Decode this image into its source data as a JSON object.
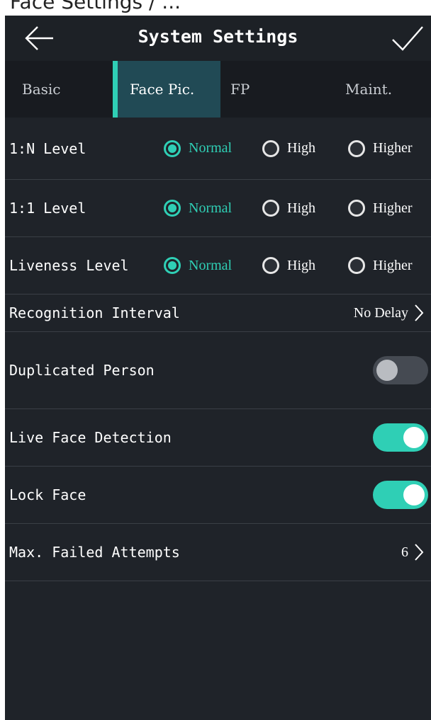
{
  "top_strip_text": "Face Settings / ...",
  "header": {
    "title": "System Settings"
  },
  "tabs": [
    {
      "label": "Basic",
      "active": false
    },
    {
      "label": "Face Pic.",
      "active": true
    },
    {
      "label": "FP",
      "active": false
    },
    {
      "label": "Maint.",
      "active": false
    }
  ],
  "radio_options": [
    "Normal",
    "High",
    "Higher"
  ],
  "levels": [
    {
      "label": "1:N Level",
      "selected": "Normal"
    },
    {
      "label": "1:1 Level",
      "selected": "Normal"
    },
    {
      "label": "Liveness Level",
      "selected": "Normal"
    }
  ],
  "recognition_interval": {
    "label": "Recognition Interval",
    "value": "No Delay"
  },
  "toggles": [
    {
      "label": "Duplicated Person",
      "on": false
    },
    {
      "label": "Live Face Detection",
      "on": true
    },
    {
      "label": "Lock Face",
      "on": true
    }
  ],
  "max_failed_attempts": {
    "label": "Max. Failed Attempts",
    "value": "6"
  },
  "colors": {
    "accent": "#2fcfb5",
    "background": "#1f2329",
    "header": "#1d2126",
    "tab_bar": "#181b20",
    "active_tab": "#214a55",
    "toggle_off": "#454a52",
    "divider": "#3a3f46"
  },
  "icons": {
    "back": "arrow-left-icon",
    "confirm": "checkmark-icon",
    "chevron": "chevron-right-icon"
  }
}
